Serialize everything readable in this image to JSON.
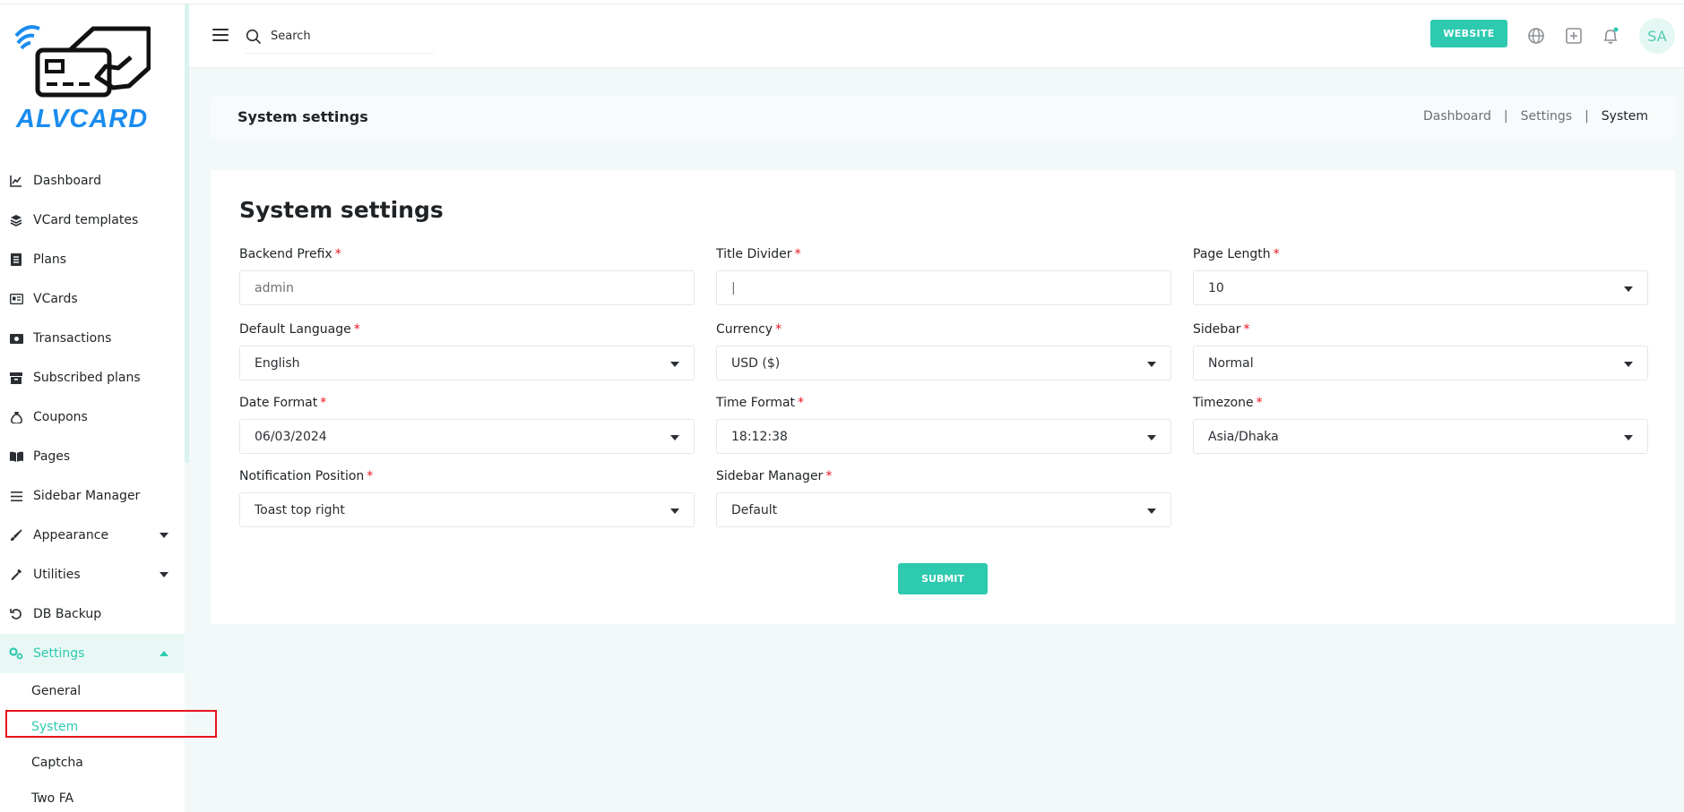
{
  "brand": {
    "logo_text": "ALVCARD",
    "accent": "#2ecab0",
    "logo_blue": "#1a8cf0"
  },
  "sidebar": {
    "items": [
      {
        "label": "Dashboard",
        "icon": "chart-line-icon"
      },
      {
        "label": "VCard templates",
        "icon": "layers-icon"
      },
      {
        "label": "Plans",
        "icon": "list-icon"
      },
      {
        "label": "VCards",
        "icon": "id-card-icon"
      },
      {
        "label": "Transactions",
        "icon": "money-icon"
      },
      {
        "label": "Subscribed plans",
        "icon": "archive-icon"
      },
      {
        "label": "Coupons",
        "icon": "money-bag-icon"
      },
      {
        "label": "Pages",
        "icon": "book-icon"
      },
      {
        "label": "Sidebar Manager",
        "icon": "bars-icon"
      },
      {
        "label": "Appearance",
        "icon": "brush-icon"
      },
      {
        "label": "Utilities",
        "icon": "wrench-icon"
      },
      {
        "label": "DB Backup",
        "icon": "undo-icon"
      },
      {
        "label": "Settings",
        "icon": "cogs-icon"
      }
    ],
    "settings_sub": [
      {
        "label": "General"
      },
      {
        "label": "System"
      },
      {
        "label": "Captcha"
      },
      {
        "label": "Two FA"
      }
    ]
  },
  "header": {
    "search_placeholder": "Search",
    "website_label": "WEBSITE",
    "avatar_initials": "SA"
  },
  "breadcrumb": {
    "title": "System settings",
    "items": [
      "Dashboard",
      "Settings",
      "System"
    ],
    "separator": "|"
  },
  "form": {
    "title": "System settings",
    "fields": {
      "backend_prefix": {
        "label": "Backend Prefix",
        "required": "*",
        "value": "admin"
      },
      "title_divider": {
        "label": "Title Divider",
        "required": "*",
        "value": "|"
      },
      "page_length": {
        "label": "Page Length",
        "required": "*",
        "value": "10"
      },
      "default_language": {
        "label": "Default Language",
        "required": "*",
        "value": "English"
      },
      "currency": {
        "label": "Currency",
        "required": "*",
        "value": "USD ($)"
      },
      "sidebar": {
        "label": "Sidebar",
        "required": "*",
        "value": "Normal"
      },
      "date_format": {
        "label": "Date Format",
        "required": "*",
        "value": "06/03/2024"
      },
      "time_format": {
        "label": "Time Format",
        "required": "*",
        "value": "18:12:38"
      },
      "timezone": {
        "label": "Timezone",
        "required": "*",
        "value": "Asia/Dhaka"
      },
      "notification_position": {
        "label": "Notification Position",
        "required": "*",
        "value": "Toast top right"
      },
      "sidebar_manager": {
        "label": "Sidebar Manager",
        "required": "*",
        "value": "Default"
      }
    },
    "submit_label": "SUBMIT"
  }
}
